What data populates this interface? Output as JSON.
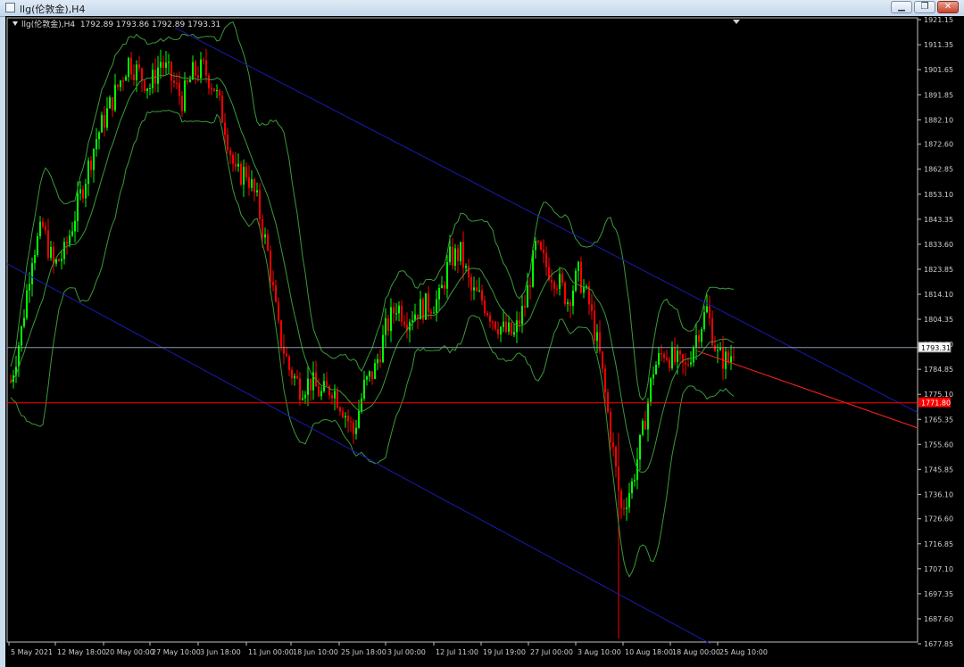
{
  "window": {
    "title": "llg(伦敦金),H4",
    "buttons": {
      "minimize": "▁",
      "restore": "❐",
      "close": "✕"
    }
  },
  "chart_header": {
    "symbol": "llg(伦敦金),H4",
    "ohlc": "1792.89 1793.86 1792.89 1793.31"
  },
  "chart_data": {
    "type": "candlestick",
    "y_ticks": [
      "1921.15",
      "1911.35",
      "1901.65",
      "1891.85",
      "1882.10",
      "1872.60",
      "1862.85",
      "1853.10",
      "1843.35",
      "1833.60",
      "1823.85",
      "1814.10",
      "1804.35",
      "1794.60",
      "1784.85",
      "1775.10",
      "1765.35",
      "1755.60",
      "1745.85",
      "1736.10",
      "1726.60",
      "1716.85",
      "1707.10",
      "1697.35",
      "1687.60",
      "1677.85"
    ],
    "x_ticks": [
      "5 May 2021",
      "12 May 18:00",
      "20 May 00:00",
      "27 May 10:00",
      "3 Jun 18:00",
      "11 Jun 00:00",
      "18 Jun 10:00",
      "25 Jun 18:00",
      "3 Jul 00:00",
      "12 Jul 11:00",
      "19 Jul 19:00",
      "27 Jul 00:00",
      "3 Aug 10:00",
      "10 Aug 18:00",
      "18 Aug 00:00",
      "25 Aug 10:00"
    ],
    "current_price_label": "1793.31",
    "red_level_label": "1771.80",
    "ylim": [
      1677.85,
      1921.15
    ],
    "colors": {
      "bull": "#00ff00",
      "bear": "#ff0000",
      "bands": "#3a9a3a",
      "channel": "#1a1ab0",
      "trend": "#ff2020",
      "price_line": "#8a9aa8"
    },
    "close_path": [
      [
        0,
        1780
      ],
      [
        4,
        1800
      ],
      [
        8,
        1830
      ],
      [
        12,
        1840
      ],
      [
        16,
        1825
      ],
      [
        20,
        1830
      ],
      [
        24,
        1845
      ],
      [
        28,
        1860
      ],
      [
        32,
        1875
      ],
      [
        36,
        1885
      ],
      [
        40,
        1895
      ],
      [
        44,
        1905
      ],
      [
        48,
        1900
      ],
      [
        52,
        1895
      ],
      [
        56,
        1905
      ],
      [
        60,
        1898
      ],
      [
        64,
        1890
      ],
      [
        68,
        1900
      ],
      [
        72,
        1902
      ],
      [
        76,
        1895
      ],
      [
        80,
        1880
      ],
      [
        84,
        1860
      ],
      [
        88,
        1862
      ],
      [
        92,
        1850
      ],
      [
        96,
        1830
      ],
      [
        100,
        1800
      ],
      [
        104,
        1785
      ],
      [
        108,
        1778
      ],
      [
        112,
        1780
      ],
      [
        116,
        1775
      ],
      [
        120,
        1778
      ],
      [
        124,
        1770
      ],
      [
        128,
        1760
      ],
      [
        132,
        1778
      ],
      [
        136,
        1785
      ],
      [
        140,
        1800
      ],
      [
        144,
        1810
      ],
      [
        148,
        1805
      ],
      [
        152,
        1808
      ],
      [
        156,
        1810
      ],
      [
        160,
        1812
      ],
      [
        164,
        1828
      ],
      [
        168,
        1830
      ],
      [
        172,
        1815
      ],
      [
        176,
        1812
      ],
      [
        180,
        1805
      ],
      [
        184,
        1800
      ],
      [
        188,
        1798
      ],
      [
        192,
        1810
      ],
      [
        196,
        1832
      ],
      [
        200,
        1825
      ],
      [
        204,
        1820
      ],
      [
        208,
        1812
      ],
      [
        212,
        1822
      ],
      [
        216,
        1810
      ],
      [
        220,
        1790
      ],
      [
        224,
        1760
      ],
      [
        228,
        1730
      ],
      [
        232,
        1740
      ],
      [
        236,
        1760
      ],
      [
        240,
        1785
      ],
      [
        244,
        1792
      ],
      [
        248,
        1788
      ],
      [
        252,
        1785
      ],
      [
        256,
        1798
      ],
      [
        260,
        1808
      ],
      [
        264,
        1790
      ],
      [
        268,
        1788
      ],
      [
        270,
        1793.31
      ]
    ]
  }
}
